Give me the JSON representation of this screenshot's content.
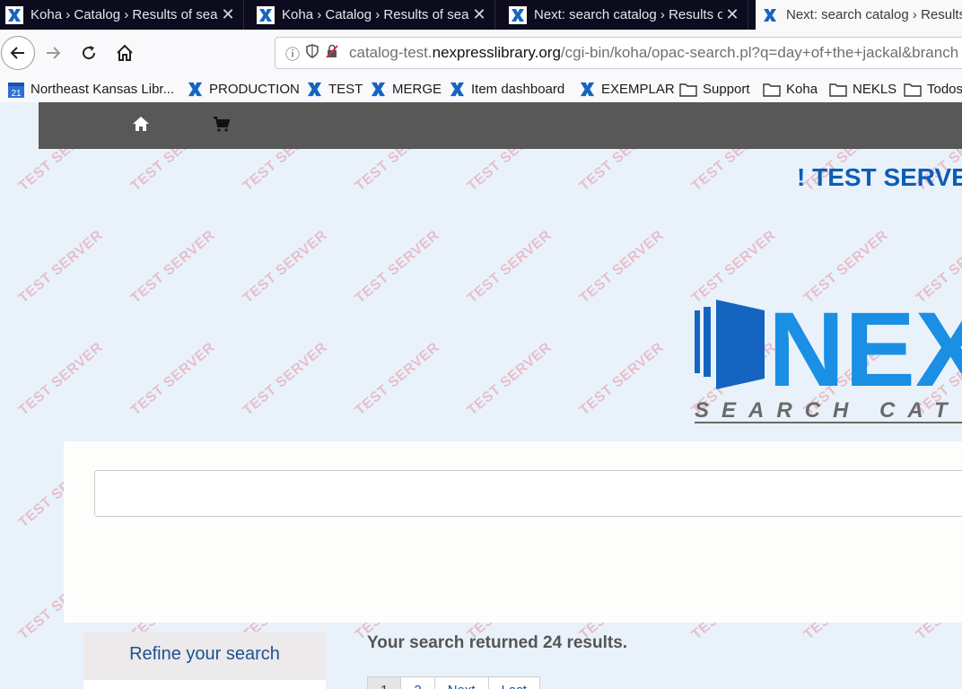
{
  "browser": {
    "tabs": [
      {
        "title": "Koha › Catalog › Results of search",
        "active": false
      },
      {
        "title": "Koha › Catalog › Results of search",
        "active": false
      },
      {
        "title": "Next: search catalog › Results of search",
        "active": false
      },
      {
        "title": "Next: search catalog › Results of search",
        "active": true
      }
    ],
    "url": {
      "prefix": "catalog-test.",
      "domain": "nexpresslibrary.org",
      "path": "/cgi-bin/koha/opac-search.pl?q=day+of+the+jackal&branch"
    },
    "bookmarks": [
      {
        "label": "Northeast Kansas Libr...",
        "icon": "calendar-icon",
        "badge": "21"
      },
      {
        "label": "PRODUCTION",
        "icon": "x-logo-icon"
      },
      {
        "label": "TEST",
        "icon": "x-logo-icon"
      },
      {
        "label": "MERGE",
        "icon": "x-logo-icon"
      },
      {
        "label": "Item dashboard",
        "icon": "x-logo-icon"
      },
      {
        "label": "EXEMPLAR",
        "icon": "x-logo-icon"
      },
      {
        "label": "Support",
        "icon": "folder-icon"
      },
      {
        "label": "Koha",
        "icon": "folder-icon"
      },
      {
        "label": "NEKLS",
        "icon": "folder-icon"
      },
      {
        "label": "Todos",
        "icon": "folder-icon"
      }
    ]
  },
  "page": {
    "watermark": "TEST SERVER",
    "banner": "! TEST SERVER",
    "logo": {
      "text": "NEX",
      "subtitle": "SEARCH CAT"
    },
    "sidebar": {
      "refine": "Refine your search"
    },
    "results_text": "Your search returned 24 results.",
    "pagination": [
      "1",
      "2",
      "Next",
      "Last"
    ]
  },
  "colors": {
    "tabstrip": "#0c0c1e",
    "brand_blue": "#0d5db5",
    "logo_blue": "#1a8fe3",
    "nav_gray": "#585858",
    "watermark": "#e896a0"
  }
}
